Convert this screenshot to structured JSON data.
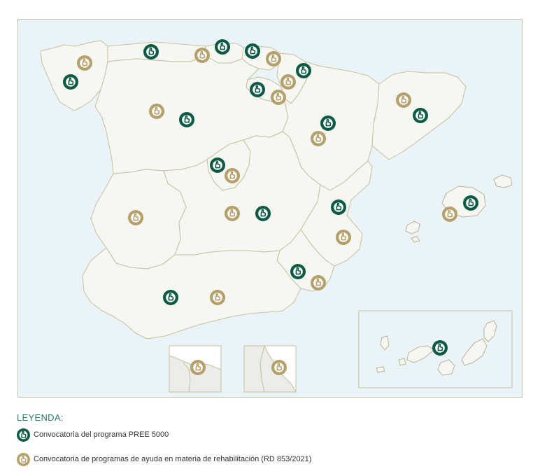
{
  "colors": {
    "pree": "#0d5a44",
    "rehab": "#b5a06b",
    "sea": "#eaf4f8",
    "land": "#f6f6f2",
    "border": "#c5c19c",
    "legend_title": "#2a7a68"
  },
  "legend": {
    "title": "LEYENDA:",
    "items": [
      {
        "type": "pree",
        "label": "Convocatoria del programa PREE 5000",
        "icon": "hand-pointer-icon"
      },
      {
        "type": "rehab",
        "label": "Convocatoria de programas de ayuda en materia de rehabilitación (RD 853/2021)",
        "icon": "hand-pointer-icon"
      }
    ]
  },
  "markers": [
    {
      "id": "galicia-pree",
      "type": "pree"
    },
    {
      "id": "galicia-rehab",
      "type": "rehab"
    },
    {
      "id": "asturias-pree",
      "type": "pree"
    },
    {
      "id": "asturias-rehab",
      "type": "rehab"
    },
    {
      "id": "cantabria-pree",
      "type": "pree"
    },
    {
      "id": "paisvasco-pree",
      "type": "pree"
    },
    {
      "id": "paisvasco-rehab",
      "type": "rehab"
    },
    {
      "id": "navarra-pree",
      "type": "pree"
    },
    {
      "id": "navarra-rehab",
      "type": "rehab"
    },
    {
      "id": "larioja-pree",
      "type": "pree"
    },
    {
      "id": "larioja-rehab",
      "type": "rehab"
    },
    {
      "id": "castillayleon-rehab",
      "type": "rehab"
    },
    {
      "id": "castillayleon-pree",
      "type": "pree"
    },
    {
      "id": "aragon-pree",
      "type": "pree"
    },
    {
      "id": "aragon-rehab",
      "type": "rehab"
    },
    {
      "id": "cataluna-rehab",
      "type": "rehab"
    },
    {
      "id": "cataluna-pree",
      "type": "pree"
    },
    {
      "id": "madrid-pree",
      "type": "pree"
    },
    {
      "id": "madrid-rehab",
      "type": "rehab"
    },
    {
      "id": "extremadura-rehab",
      "type": "rehab"
    },
    {
      "id": "castillalamancha-rehab",
      "type": "rehab"
    },
    {
      "id": "castillalamancha-pree",
      "type": "pree"
    },
    {
      "id": "valencia-pree",
      "type": "pree"
    },
    {
      "id": "valencia-rehab",
      "type": "rehab"
    },
    {
      "id": "baleares-rehab",
      "type": "rehab"
    },
    {
      "id": "baleares-pree",
      "type": "pree"
    },
    {
      "id": "murcia-pree",
      "type": "pree"
    },
    {
      "id": "murcia-rehab",
      "type": "rehab"
    },
    {
      "id": "andalucia-pree",
      "type": "pree"
    },
    {
      "id": "andalucia-rehab",
      "type": "rehab"
    },
    {
      "id": "ceuta-rehab",
      "type": "rehab"
    },
    {
      "id": "melilla-rehab",
      "type": "rehab"
    },
    {
      "id": "canarias-pree",
      "type": "pree"
    }
  ]
}
